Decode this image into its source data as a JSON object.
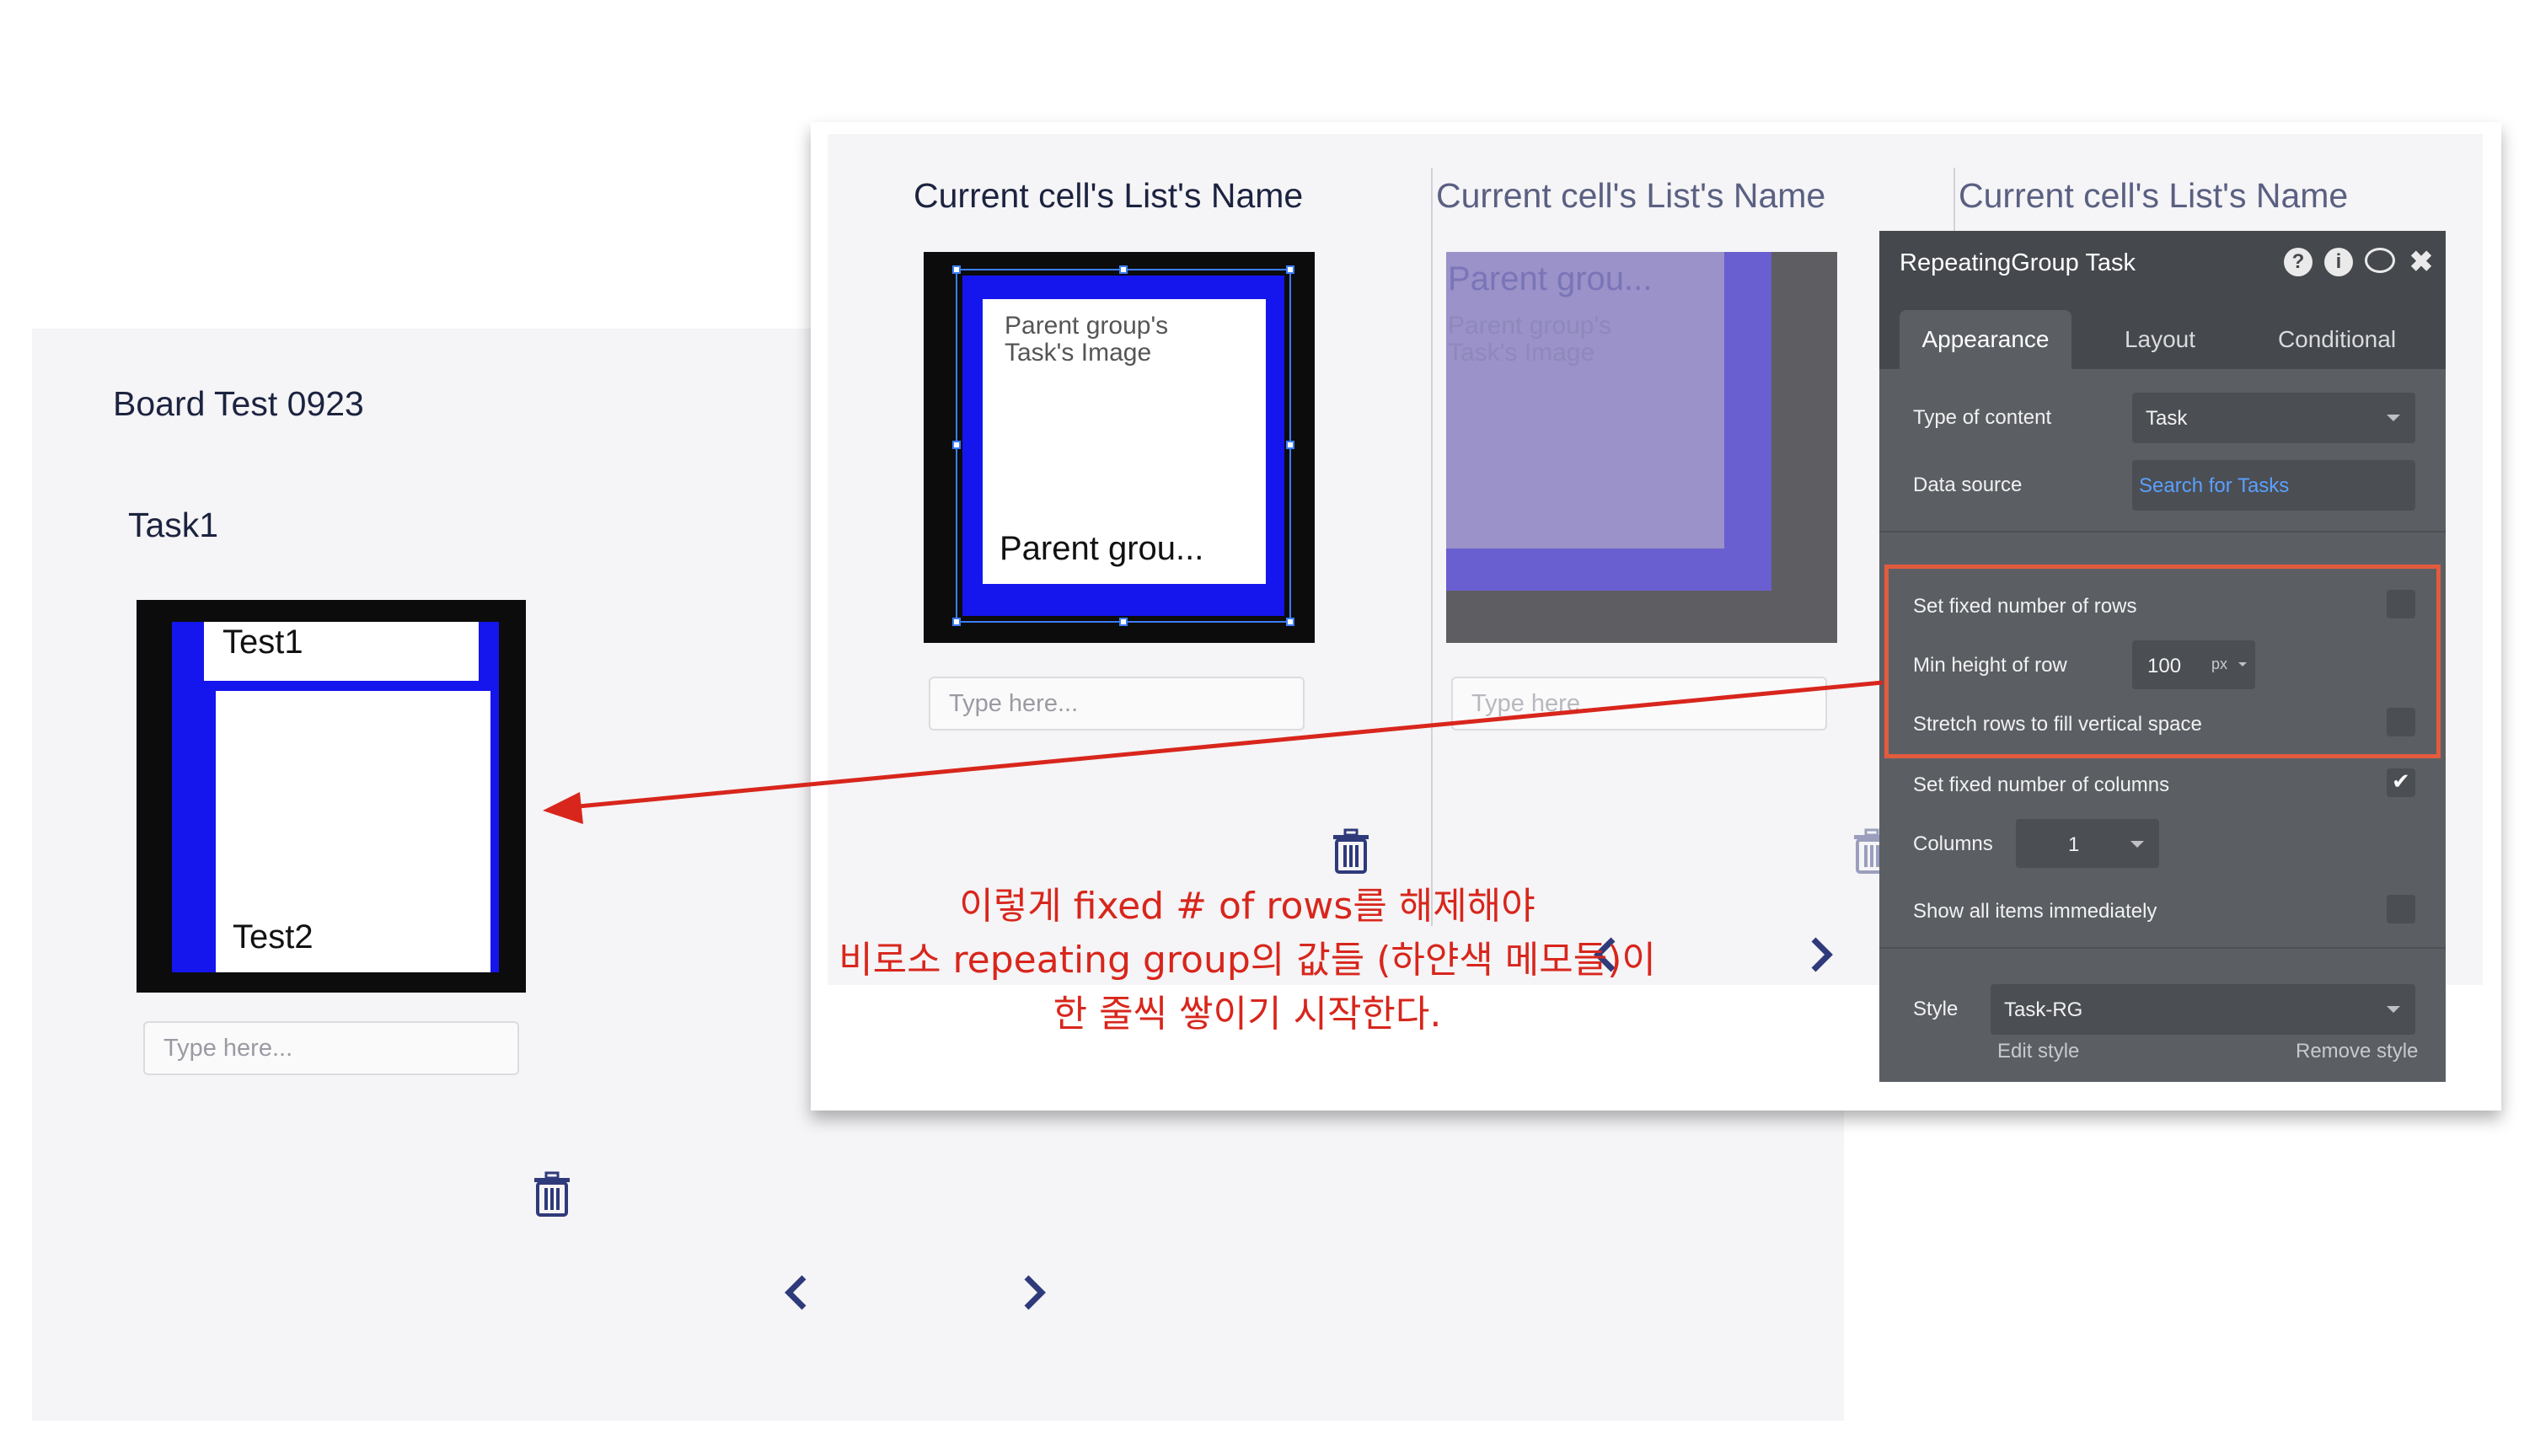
{
  "left_page": {
    "board_title": "Board Test 0923",
    "task_title": "Task1",
    "cell_text_1": "Test1",
    "cell_text_2": "Test2",
    "input_placeholder": "Type here..."
  },
  "right_page": {
    "column_titles": [
      "Current cell's List's Name",
      "Current cell's List's Name",
      "Current cell's List's Name"
    ],
    "image_label": "Parent group's Task's Image",
    "name_text": "Parent grou...",
    "input_placeholder": "Type here..."
  },
  "panel": {
    "title": "RepeatingGroup Task",
    "tabs": [
      "Appearance",
      "Layout",
      "Conditional"
    ],
    "type_of_content_label": "Type of content",
    "type_of_content_value": "Task",
    "data_source_label": "Data source",
    "data_source_value": "Search for Tasks",
    "fixed_rows_label": "Set fixed number of rows",
    "fixed_rows_checked": false,
    "min_height_label": "Min height of row",
    "min_height_value": "100",
    "min_height_unit": "px",
    "stretch_rows_label": "Stretch rows to fill vertical space",
    "stretch_rows_checked": false,
    "fixed_cols_label": "Set fixed number of columns",
    "fixed_cols_checked": true,
    "columns_label": "Columns",
    "columns_value": "1",
    "show_all_label": "Show all items immediately",
    "show_all_checked": false,
    "style_label": "Style",
    "style_value": "Task-RG",
    "edit_style": "Edit style",
    "remove_style": "Remove style"
  },
  "annotation": {
    "line1": "이렇게 fixed # of rows를 해제해야",
    "line2": "비로소 repeating group의 값들 (하얀색 메모들)이",
    "line3": "한 줄씩 쌓이기 시작한다."
  },
  "colors": {
    "annotation_red": "#d8261c",
    "highlight_box": "#e25b3e",
    "cell_blue": "#1515ee",
    "panel_bg": "#5b5f64",
    "link_blue": "#5aa0ff"
  },
  "icons": [
    "trash-icon",
    "chevron-left-icon",
    "chevron-right-icon",
    "help-icon",
    "info-icon",
    "comment-icon",
    "close-icon",
    "dropdown-caret-icon",
    "checkmark-icon"
  ]
}
